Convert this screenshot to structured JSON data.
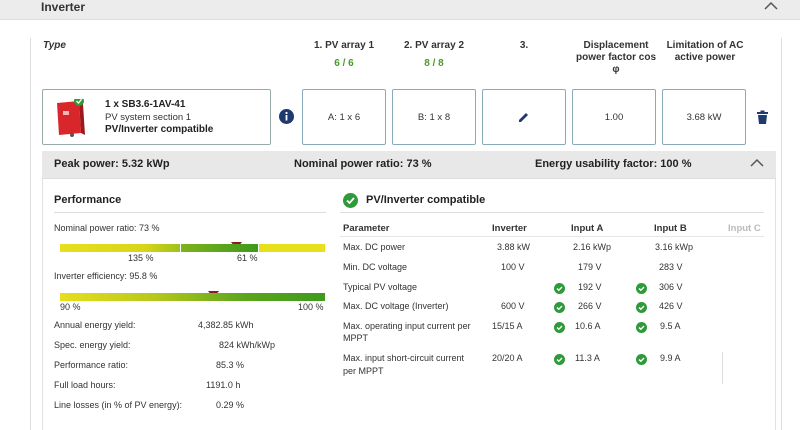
{
  "header": {
    "title": "Inverter"
  },
  "columns": {
    "type": "Type",
    "pv1": {
      "label": "1. PV array 1",
      "value": "6 / 6"
    },
    "pv2": {
      "label": "2. PV array 2",
      "value": "8 / 8"
    },
    "pv3": {
      "label": "3."
    },
    "disp": {
      "line1": "Displacement",
      "line2": "power factor cos",
      "line3": "φ"
    },
    "limit": {
      "line1": "Limitation of AC",
      "line2": "active power"
    }
  },
  "inverter": {
    "name": "1 x SB3.6-1AV-41",
    "section": "PV system section 1",
    "compatibility": "PV/Inverter compatible"
  },
  "cells": {
    "a": "A: 1 x 6",
    "b": "B: 1 x 8",
    "cos": "1.00",
    "limit": "3.68 kW"
  },
  "summary": {
    "peak": "Peak power: 5.32 kWp",
    "nominal": "Nominal power ratio: 73 %",
    "usability": "Energy usability factor: 100 %"
  },
  "performance": {
    "title": "Performance",
    "nominal_label": "Nominal power ratio: 73 %",
    "nominal_bar": {
      "marker": 0.73,
      "low_label": "135 %",
      "high_label": "61 %"
    },
    "efficiency_label": "Inverter efficiency: 95.8 %",
    "efficiency_bar": {
      "marker": 0.958,
      "low_label": "90 %",
      "high_label": "100 %"
    },
    "rows": [
      {
        "label": "Annual energy yield:",
        "value": "4,382.85 kWh"
      },
      {
        "label": "Spec. energy yield:",
        "value": "824 kWh/kWp"
      },
      {
        "label": "Performance ratio:",
        "value": "85.3 %"
      },
      {
        "label": "Full load hours:",
        "value": "1191.0 h"
      },
      {
        "label": "Line losses (in % of PV energy):",
        "value": "0.29 %"
      }
    ]
  },
  "compat": {
    "title": "PV/Inverter compatible",
    "headers": {
      "param": "Parameter",
      "inv": "Inverter",
      "a": "Input A",
      "b": "Input B",
      "c": "Input C"
    },
    "rows": [
      {
        "param": "Max. DC power",
        "inv": "3.88 kW",
        "a": "2.16 kWp",
        "b": "3.16 kWp"
      },
      {
        "param": "Min. DC voltage",
        "inv": "100 V",
        "a": "179 V",
        "b": "283 V"
      },
      {
        "param": "Typical PV voltage",
        "inv": "",
        "a": "192 V",
        "b": "306 V"
      },
      {
        "param": "Max. DC voltage (Inverter)",
        "inv": "600 V",
        "a": "266 V",
        "b": "426 V"
      },
      {
        "param": "Max. operating input current per",
        "param2": "MPPT",
        "inv": "15/15 A",
        "a": "10.6 A",
        "b": "9.5 A"
      },
      {
        "param": "Max. input short-circuit current",
        "param2": "per MPPT",
        "inv": "20/20 A",
        "a": "11.3 A",
        "b": "9.9 A"
      }
    ]
  }
}
